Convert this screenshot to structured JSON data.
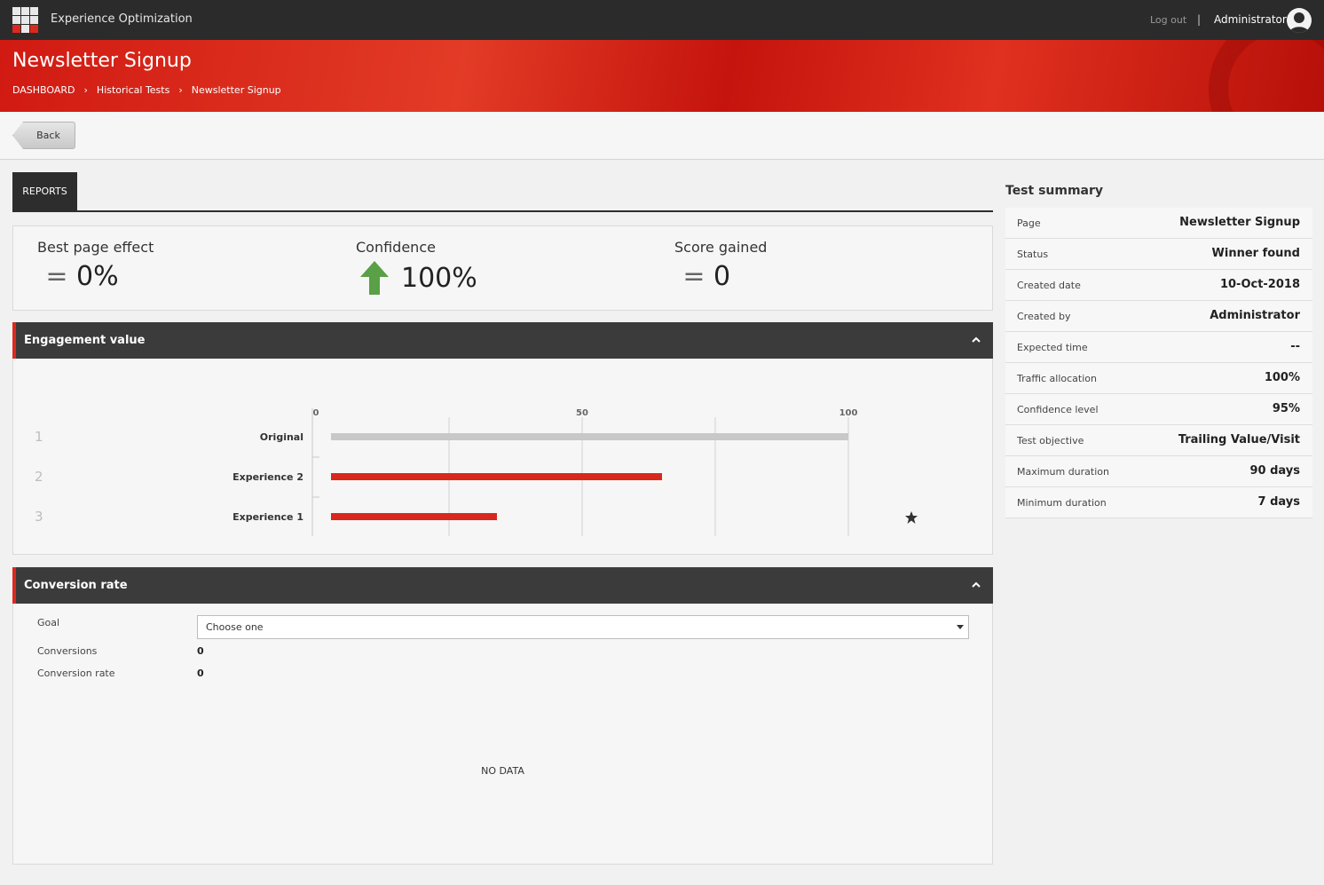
{
  "app": {
    "title": "Experience Optimization",
    "logout_label": "Log out",
    "separator": "|",
    "user_name": "Administrator"
  },
  "header": {
    "page_title": "Newsletter Signup",
    "breadcrumb": [
      "DASHBOARD",
      "Historical Tests",
      "Newsletter Signup"
    ]
  },
  "toolbar": {
    "back_label": "Back"
  },
  "tabs": [
    {
      "label": "REPORTS",
      "active": true
    }
  ],
  "kpis": {
    "best_page_effect": {
      "label": "Best page effect",
      "indicator": "=",
      "value": "0%"
    },
    "confidence": {
      "label": "Confidence",
      "indicator": "arrow-up-icon",
      "value": "100%"
    },
    "score_gained": {
      "label": "Score gained",
      "indicator": "=",
      "value": "0"
    }
  },
  "engagement": {
    "title": "Engagement value",
    "chart_data": {
      "type": "bar",
      "orientation": "horizontal",
      "categories": [
        "Original",
        "Experience 2",
        "Experience 1"
      ],
      "ranks": [
        "1",
        "2",
        "3"
      ],
      "values": [
        100,
        65,
        34
      ],
      "xlim": [
        0,
        100
      ],
      "x_ticks": [
        "0",
        "50",
        "100"
      ],
      "bar_colors": [
        "#c8c8c8",
        "#d9271d",
        "#d9271d"
      ],
      "winner_marker": "star-icon",
      "grid": true
    }
  },
  "conversion": {
    "title": "Conversion rate",
    "goal_label": "Goal",
    "goal_selected": "Choose one",
    "conversions_label": "Conversions",
    "conversions_value": "0",
    "rate_label": "Conversion rate",
    "rate_value": "0",
    "no_data": "NO DATA"
  },
  "summary": {
    "title": "Test summary",
    "rows": [
      {
        "key": "Page",
        "value": "Newsletter Signup"
      },
      {
        "key": "Status",
        "value": "Winner found"
      },
      {
        "key": "Created date",
        "value": "10-Oct-2018"
      },
      {
        "key": "Created by",
        "value": "Administrator"
      },
      {
        "key": "Expected time",
        "value": "--"
      },
      {
        "key": "Traffic allocation",
        "value": "100%"
      },
      {
        "key": "Confidence level",
        "value": "95%"
      },
      {
        "key": "Test objective",
        "value": "Trailing Value/Visit"
      },
      {
        "key": "Maximum duration",
        "value": "90 days"
      },
      {
        "key": "Minimum duration",
        "value": "7 days"
      }
    ]
  },
  "colors": {
    "accent": "#dc291e",
    "topbar": "#2b2b2b",
    "section_header": "#3b3b3b",
    "positive": "#5aa046"
  }
}
